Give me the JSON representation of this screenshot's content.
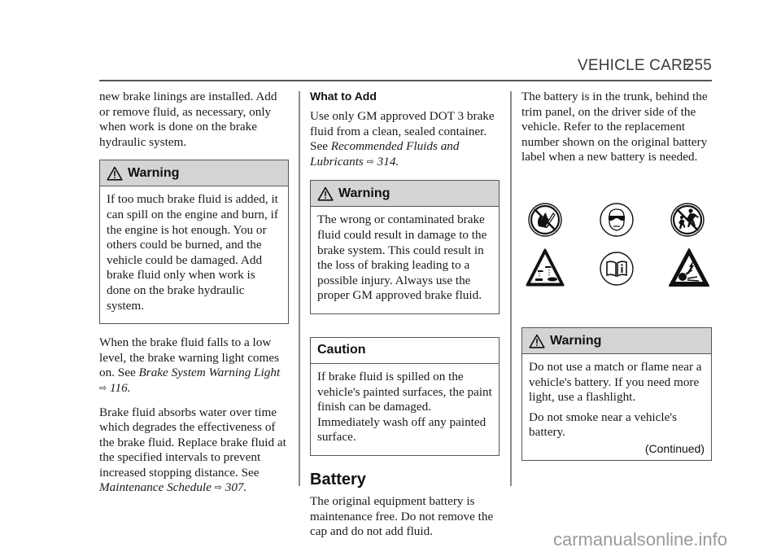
{
  "header": {
    "section": "VEHICLE CARE",
    "page_number": "255"
  },
  "column1": {
    "intro": "new brake linings are installed. Add or remove fluid, as necessary, only when work is done on the brake hydraulic system.",
    "warning": {
      "title": "Warning",
      "text": "If too much brake fluid is added, it can spill on the engine and burn, if the engine is hot enough. You or others could be burned, and the vehicle could be damaged. Add brake fluid only when work is done on the brake hydraulic system."
    },
    "para1": {
      "text": "When the brake fluid falls to a low level, the brake warning light comes on. See ",
      "ref": "Brake System Warning Light",
      "ref_arrow": "⇨",
      "ref_page": "116",
      "end": "."
    },
    "para2": {
      "text": "Brake fluid absorbs water over time which degrades the effectiveness of the brake fluid. Replace brake fluid at the specified intervals to prevent increased stopping distance. See ",
      "ref": "Maintenance Schedule",
      "ref_arrow": "⇨",
      "ref_page": "307",
      "end": "."
    }
  },
  "column2": {
    "what_to_add_heading": "What to Add",
    "what_to_add": {
      "text": "Use only GM approved DOT 3 brake fluid from a clean, sealed container. See ",
      "ref": "Recommended Fluids and Lubricants",
      "ref_arrow": "⇨",
      "ref_page": "314",
      "end": "."
    },
    "warning": {
      "title": "Warning",
      "text": "The wrong or contaminated brake fluid could result in damage to the brake system. This could result in the loss of braking leading to a possible injury. Always use the proper GM approved brake fluid."
    },
    "caution": {
      "title": "Caution",
      "text": "If brake fluid is spilled on the vehicle's painted surfaces, the paint finish can be damaged. Immediately wash off any painted surface."
    },
    "battery_heading": "Battery",
    "battery_text": "The original equipment battery is maintenance free. Do not remove the cap and do not add fluid."
  },
  "column3": {
    "location_text": "The battery is in the trunk, behind the trim panel, on the driver side of the vehicle. Refer to the replacement number shown on the original battery label when a new battery is needed.",
    "symbols": [
      "no-flame-smoking-icon",
      "eye-protection-icon",
      "keep-children-away-icon",
      "corrosive-acid-icon",
      "read-manual-icon",
      "explosive-gas-icon"
    ],
    "warning": {
      "title": "Warning",
      "text1": "Do not use a match or flame near a vehicle's battery. If you need more light, use a flashlight.",
      "text2": "Do not smoke near a vehicle's battery.",
      "continued": "(Continued)"
    }
  },
  "watermark": "carmanualsonline.info"
}
